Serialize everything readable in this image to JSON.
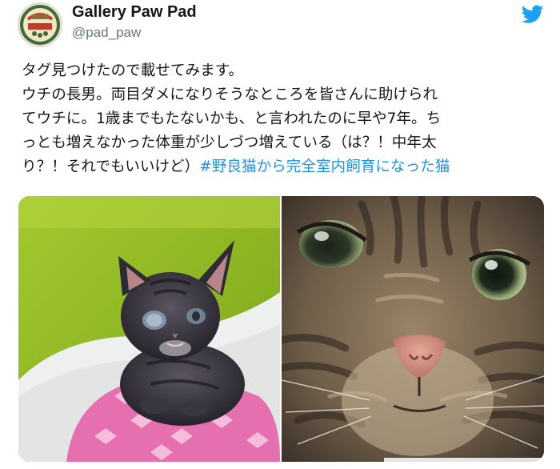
{
  "user": {
    "display_name": "Gallery Paw Pad",
    "handle": "@pad_paw",
    "avatar_icon": "gallery-paw-pad-logo"
  },
  "brand_icon": "twitter-bird-icon",
  "tweet": {
    "line1": "タグ見つけたので載せてみます。",
    "line2": "ウチの長男。両目ダメになりそうなところを皆さんに助けられ",
    "line3": "てウチに。1歳までもたないかも、と言われたのに早や7年。ち",
    "line4": "っとも増えなかった体重が少しづつ増えている（は？！中年太",
    "line5_text": "り？！それでもいいけど）",
    "hashtag": "#野良猫から完全室内飼育になった猫"
  },
  "colors": {
    "link": "#1b95e0",
    "twitter_blue": "#1da1f2",
    "secondary_text": "#657786"
  }
}
